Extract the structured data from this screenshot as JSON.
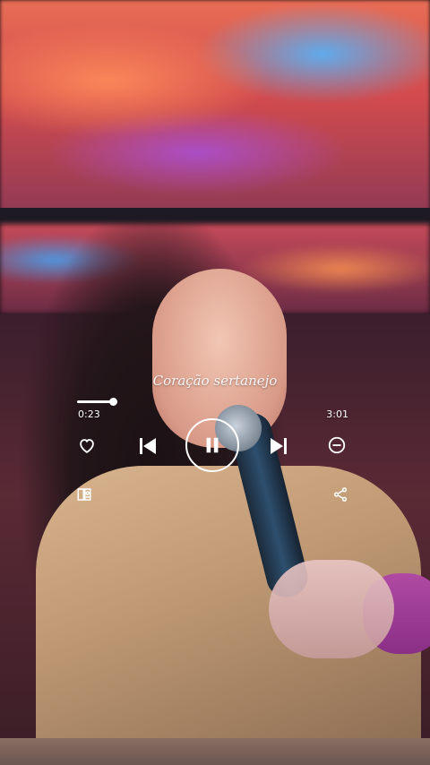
{
  "player": {
    "song_title": "Coração sertanejo",
    "elapsed": "0:23",
    "total": "3:01",
    "progress": 0.13
  },
  "icons": {
    "like": "heart-outline-icon",
    "previous": "skip-previous-icon",
    "play_pause": "pause-icon",
    "next": "skip-next-icon",
    "remove": "minus-circle-icon",
    "lyrics": "lyrics-book-icon",
    "share": "share-icon"
  },
  "colors": {
    "overlay_text": "#ffffff"
  }
}
